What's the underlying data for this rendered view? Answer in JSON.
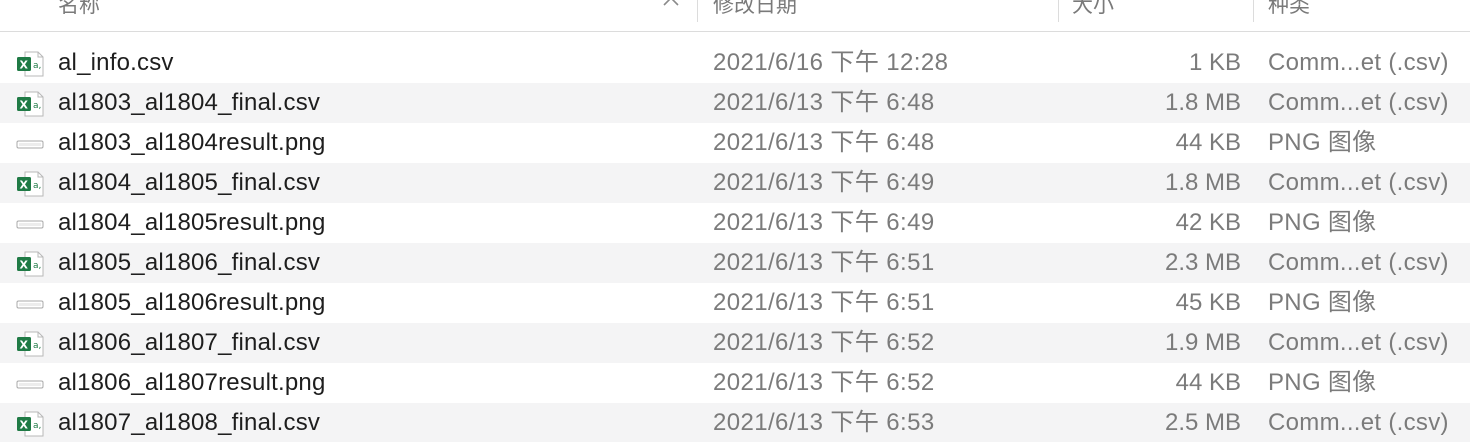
{
  "columns": {
    "name": "名称",
    "date_modified": "修改日期",
    "size": "大小",
    "kind": "种类"
  },
  "colors": {
    "excel_green": "#1f7a45",
    "alt_row": "#f4f4f5",
    "secondary_text": "#7b7b7b"
  },
  "files": [
    {
      "name": "al_info.csv",
      "date": "2021/6/16 下午 12:28",
      "size": "1 KB",
      "kind": "Comm...et (.csv)",
      "icon": "csv-file-icon"
    },
    {
      "name": "al1803_al1804_final.csv",
      "date": "2021/6/13 下午 6:48",
      "size": "1.8 MB",
      "kind": "Comm...et (.csv)",
      "icon": "csv-file-icon"
    },
    {
      "name": "al1803_al1804result.png",
      "date": "2021/6/13 下午 6:48",
      "size": "44 KB",
      "kind": "PNG 图像",
      "icon": "png-file-icon"
    },
    {
      "name": "al1804_al1805_final.csv",
      "date": "2021/6/13 下午 6:49",
      "size": "1.8 MB",
      "kind": "Comm...et (.csv)",
      "icon": "csv-file-icon"
    },
    {
      "name": "al1804_al1805result.png",
      "date": "2021/6/13 下午 6:49",
      "size": "42 KB",
      "kind": "PNG 图像",
      "icon": "png-file-icon"
    },
    {
      "name": "al1805_al1806_final.csv",
      "date": "2021/6/13 下午 6:51",
      "size": "2.3 MB",
      "kind": "Comm...et (.csv)",
      "icon": "csv-file-icon"
    },
    {
      "name": "al1805_al1806result.png",
      "date": "2021/6/13 下午 6:51",
      "size": "45 KB",
      "kind": "PNG 图像",
      "icon": "png-file-icon"
    },
    {
      "name": "al1806_al1807_final.csv",
      "date": "2021/6/13 下午 6:52",
      "size": "1.9 MB",
      "kind": "Comm...et (.csv)",
      "icon": "csv-file-icon"
    },
    {
      "name": "al1806_al1807result.png",
      "date": "2021/6/13 下午 6:52",
      "size": "44 KB",
      "kind": "PNG 图像",
      "icon": "png-file-icon"
    },
    {
      "name": "al1807_al1808_final.csv",
      "date": "2021/6/13 下午 6:53",
      "size": "2.5 MB",
      "kind": "Comm...et (.csv)",
      "icon": "csv-file-icon"
    }
  ]
}
